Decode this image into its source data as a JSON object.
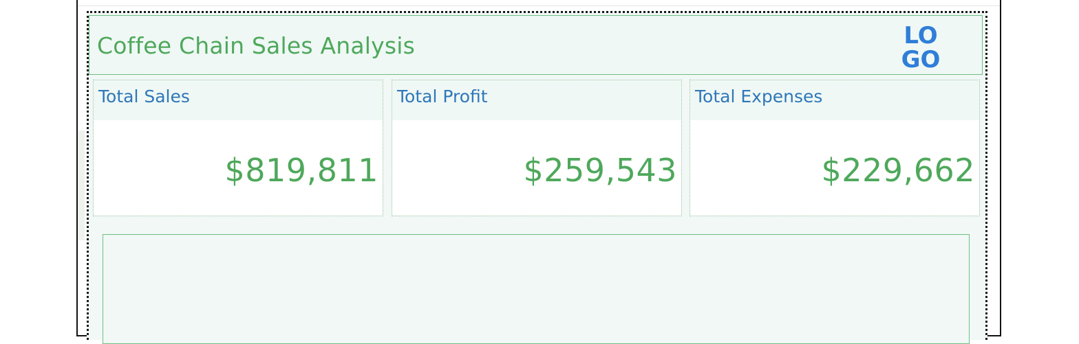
{
  "header": {
    "title": "Coffee Chain Sales Analysis",
    "logo": {
      "icon": "logo-icon",
      "line1": "LO",
      "line2": "GO",
      "color": "#2f7ed8"
    }
  },
  "kpis": [
    {
      "label": "Total Sales",
      "value": "$819,811"
    },
    {
      "label": "Total Profit",
      "value": "$259,543"
    },
    {
      "label": "Total Expenses",
      "value": "$229,662"
    }
  ],
  "colors": {
    "title": "#4ea85b",
    "kpi_label": "#2f77b8",
    "kpi_value": "#4ea85b",
    "panel_background": "#f1f8f6",
    "border_accent": "#6fbf80"
  }
}
